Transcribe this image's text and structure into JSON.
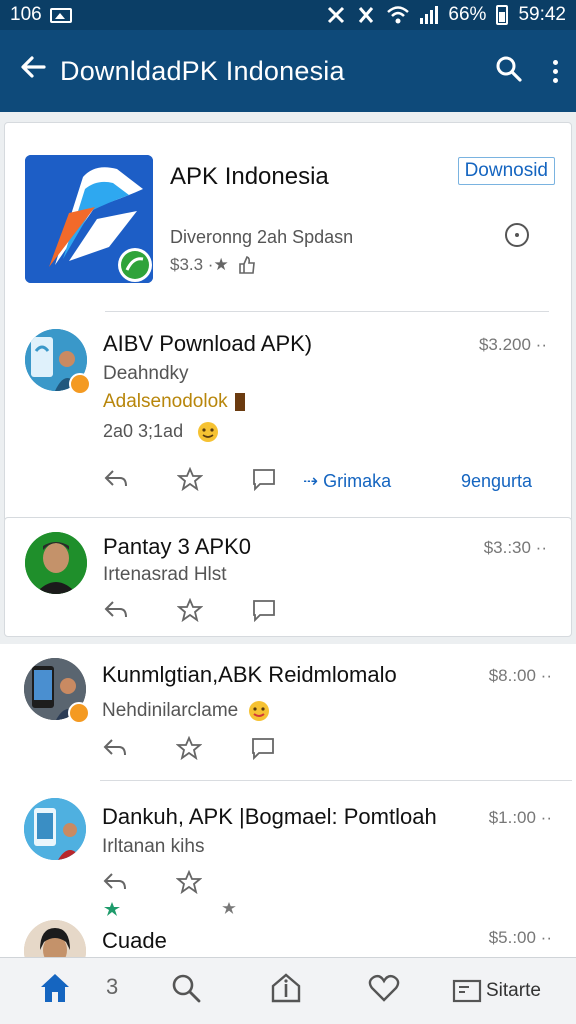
{
  "status_bar": {
    "time": "106",
    "right_text": "66%",
    "clock": "59:42"
  },
  "app_bar": {
    "title": "DownldadPK Indonesia",
    "back_icon": "arrow-left-icon",
    "search_icon": "search-icon",
    "menu_icon": "more-vert-icon"
  },
  "app_card": {
    "name": "APK Indonesia",
    "download_label": "Downosid",
    "subtitle": "Diveronng 2ah Spdasn",
    "meta": "$3.3 ·★",
    "colors": {
      "logo_bg": "#1d5ec6",
      "accent": "#1565c0"
    }
  },
  "posts": [
    {
      "title": "AIBV Pownload APK)",
      "line1": "Deahndky",
      "line2": "Adalsenodolok",
      "line3": "2a0 3;1ad",
      "price": "$3.200 ··",
      "share_label": "Grimaka",
      "more_label": "9engurta"
    },
    {
      "title": "Pantay 3 APK0",
      "line1": "Irtenasrad Hlst",
      "price": "$3.:30 ··"
    },
    {
      "title": "Kunmlgtian,ABK Reidmlomalo",
      "line1": "Nehdinilarclame",
      "price": "$8.:00 ··"
    },
    {
      "title": "Dankuh, APK |Bogmael: Pomtloah",
      "line1": "Irltanan kihs",
      "price": "$1.:00 ··"
    },
    {
      "title": "Cuade",
      "price": "$5.:00 ··"
    }
  ],
  "bottom_nav": {
    "label": "Sitarte",
    "number": "3"
  }
}
